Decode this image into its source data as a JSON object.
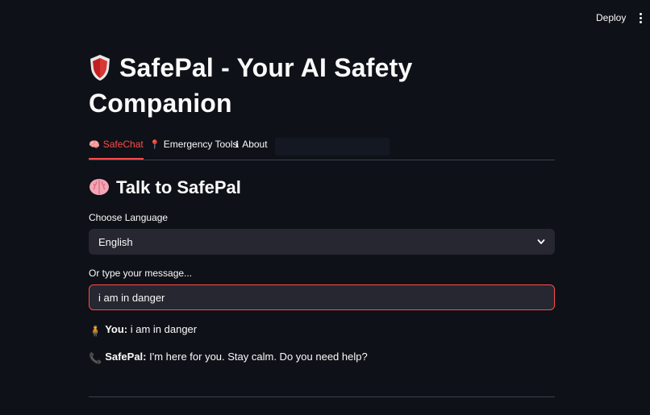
{
  "header": {
    "deploy_label": "Deploy"
  },
  "page": {
    "title_line1": "SafePal - Your AI Safety",
    "title_line2": "Companion"
  },
  "tabs": [
    {
      "label": "SafeChat",
      "icon": "brain-icon",
      "active": true
    },
    {
      "label": "Emergency Tools",
      "icon": "pushpin-icon",
      "active": false
    },
    {
      "label": "About",
      "icon": "info-icon",
      "active": false
    }
  ],
  "section": {
    "heading": "Talk to SafePal",
    "icon": "brain-icon"
  },
  "language": {
    "label": "Choose Language",
    "selected": "English"
  },
  "message": {
    "label": "Or type your message...",
    "value": "i am in danger"
  },
  "chat": [
    {
      "speaker": "You:",
      "text": "i am in danger",
      "icon": "person-icon"
    },
    {
      "speaker": "SafePal:",
      "text": "I'm here for you. Stay calm. Do you need help?",
      "icon": "phone-icon"
    }
  ],
  "colors": {
    "background": "#0e1117",
    "accent": "#ff4b4b",
    "input_bg": "#262730"
  }
}
